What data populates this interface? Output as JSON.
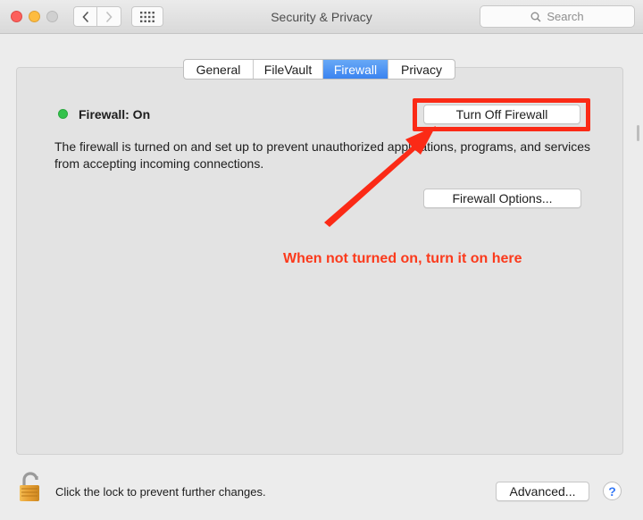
{
  "window": {
    "title": "Security & Privacy",
    "search_placeholder": "Search"
  },
  "tabs": [
    {
      "label": "General",
      "active": false
    },
    {
      "label": "FileVault",
      "active": false
    },
    {
      "label": "Firewall",
      "active": true
    },
    {
      "label": "Privacy",
      "active": false
    }
  ],
  "firewall": {
    "status_label": "Firewall: On",
    "status_color": "#33c24b",
    "toggle_button_label": "Turn Off Firewall",
    "description": "The firewall is turned on and set up to prevent unauthorized applications, programs, and services from accepting incoming connections.",
    "options_button_label": "Firewall Options..."
  },
  "annotation": {
    "text": "When not turned on, turn it on here",
    "color": "#fb3a1c"
  },
  "footer": {
    "lock_text": "Click the lock to prevent further changes.",
    "advanced_button_label": "Advanced...",
    "help_label": "?"
  },
  "icons": [
    "back-chevron-icon",
    "forward-chevron-icon",
    "grid-icon",
    "search-icon",
    "lock-icon"
  ]
}
